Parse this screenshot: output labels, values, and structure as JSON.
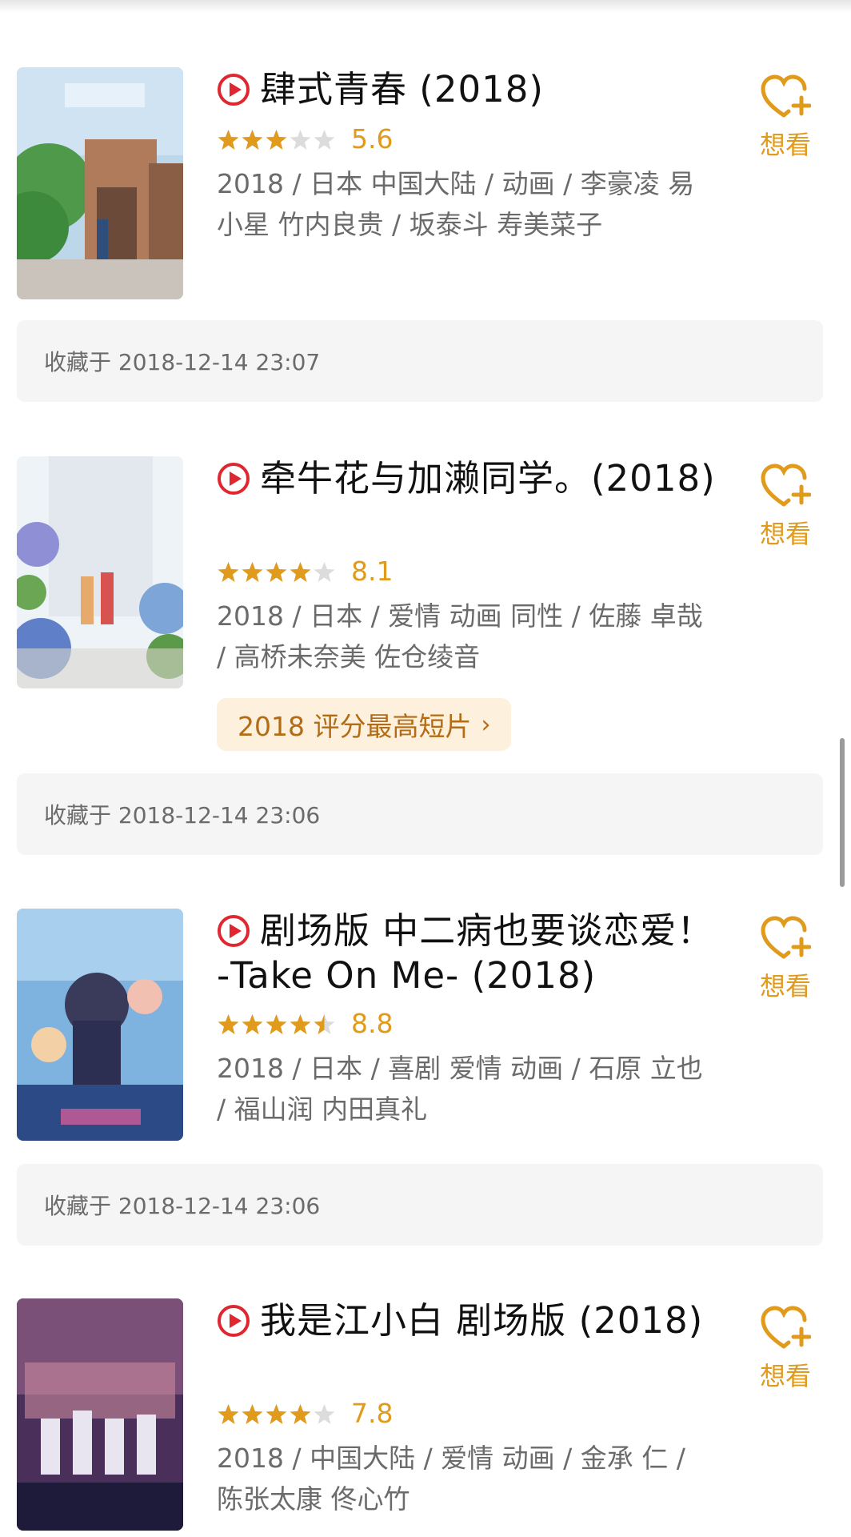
{
  "want_label": "想看",
  "accent_color": "#e09a1c",
  "play_icon_color": "#e0262f",
  "saved_prefix": "收藏于",
  "items": [
    {
      "title": "肆式青春 (2018)",
      "rating": 5.6,
      "stars": 3,
      "score_text": "5.6",
      "meta": "2018 / 日本 中国大陆 / 动画 / 李豪凌 易小星 竹内良贵 / 坂泰斗 寿美菜子",
      "saved_at": "收藏于 2018-12-14 23:07",
      "poster_icon": "anime-poster-street"
    },
    {
      "title": "牵牛花与加濑同学。(2018)",
      "rating": 8.1,
      "stars": 4,
      "score_text": "8.1",
      "meta": "2018 / 日本 / 爱情 动画 同性 / 佐藤 卓哉 / 高桥未奈美 佐仓绫音",
      "tag": "2018 评分最高短片",
      "saved_at": "收藏于 2018-12-14 23:06",
      "poster_icon": "anime-poster-flowers"
    },
    {
      "title": "剧场版 中二病也要谈恋爱！ -Take On Me- (2018)",
      "rating": 8.8,
      "stars": 4.5,
      "score_text": "8.8",
      "meta": "2018 / 日本 / 喜剧 爱情 动画 / 石原 立也 / 福山润 内田真礼",
      "saved_at": "收藏于 2018-12-14 23:06",
      "poster_icon": "anime-poster-group"
    },
    {
      "title": "我是江小白 剧场版 (2018)",
      "rating": 7.8,
      "stars": 4,
      "score_text": "7.8",
      "meta": "2018 / 中国大陆 / 爱情 动画 / 金承 仁 / 陈张太康 佟心竹",
      "poster_icon": "anime-poster-train"
    }
  ]
}
